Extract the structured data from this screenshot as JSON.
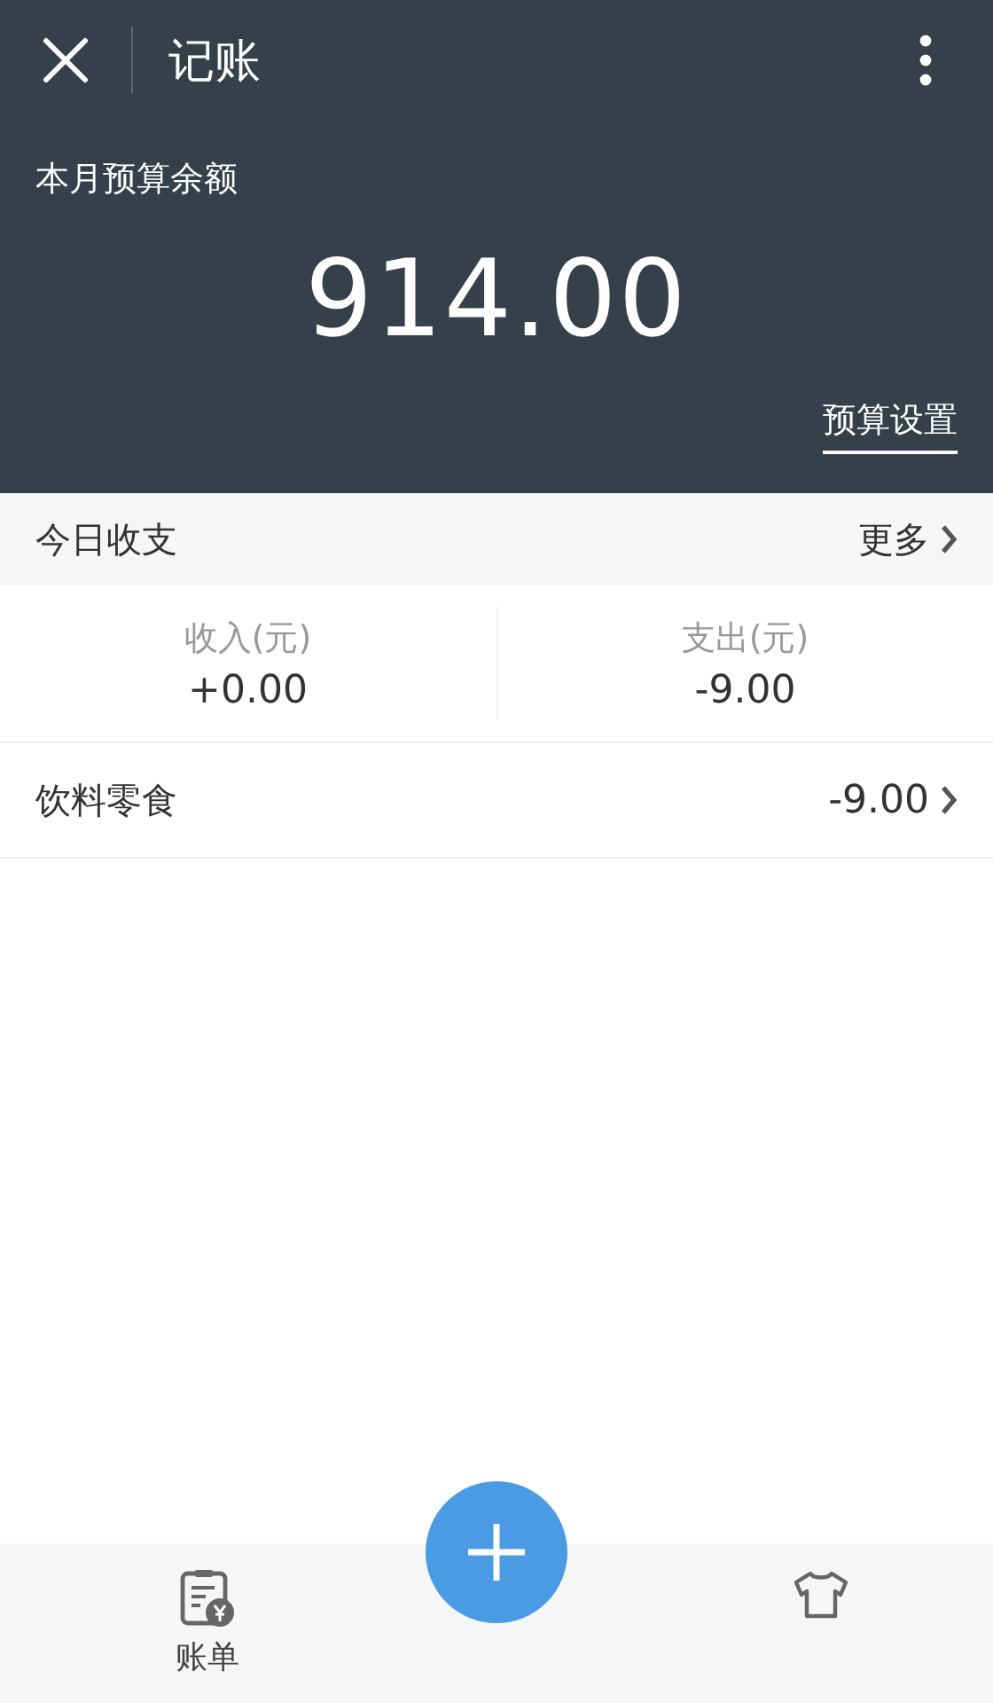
{
  "title_bar": {
    "title": "记账"
  },
  "budget": {
    "label": "本月预算余额",
    "amount": "914.00",
    "settings_link": "预算设置"
  },
  "today": {
    "title": "今日收支",
    "more": "更多",
    "stats": [
      {
        "label": "收入(元)",
        "value": "+0.00"
      },
      {
        "label": "支出(元)",
        "value": "-9.00"
      }
    ],
    "entries": [
      {
        "category": "饮料零食",
        "amount": "-9.00"
      }
    ]
  },
  "tab_bar": {
    "items": [
      {
        "label": "账单",
        "kind": "bill"
      },
      {
        "kind": "shirt"
      }
    ]
  }
}
